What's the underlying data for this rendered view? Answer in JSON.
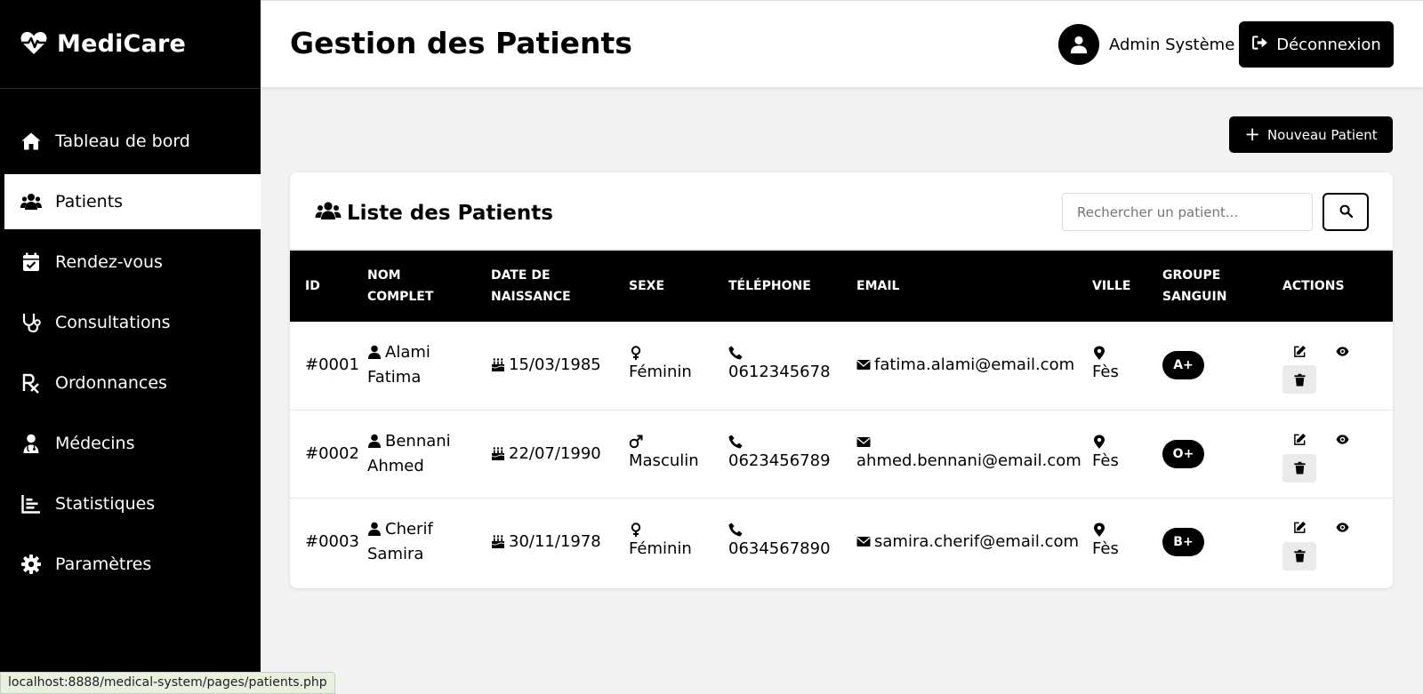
{
  "app": {
    "name": "MediCare"
  },
  "sidebar": {
    "items": [
      {
        "label": "Tableau de bord",
        "icon": "home-icon",
        "active": false
      },
      {
        "label": "Patients",
        "icon": "users-icon",
        "active": true
      },
      {
        "label": "Rendez-vous",
        "icon": "calendar-check-icon",
        "active": false
      },
      {
        "label": "Consultations",
        "icon": "stethoscope-icon",
        "active": false
      },
      {
        "label": "Ordonnances",
        "icon": "prescription-icon",
        "active": false
      },
      {
        "label": "Médecins",
        "icon": "doctor-icon",
        "active": false
      },
      {
        "label": "Statistiques",
        "icon": "chart-icon",
        "active": false
      },
      {
        "label": "Paramètres",
        "icon": "gear-icon",
        "active": false
      }
    ]
  },
  "header": {
    "title": "Gestion des Patients",
    "user_name": "Admin Système",
    "logout_label": "Déconnexion"
  },
  "toolbar": {
    "new_patient_label": "Nouveau Patient"
  },
  "list": {
    "title": "Liste des Patients",
    "search_placeholder": "Rechercher un patient...",
    "columns": [
      [
        "ID"
      ],
      [
        "NOM",
        "COMPLET"
      ],
      [
        "DATE DE",
        "NAISSANCE"
      ],
      [
        "SEXE"
      ],
      [
        "TÉLÉPHONE"
      ],
      [
        "EMAIL"
      ],
      [
        "VILLE"
      ],
      [
        "GROUPE",
        "SANGUIN"
      ],
      [
        "ACTIONS"
      ]
    ],
    "rows": [
      {
        "id": "#0001",
        "name1": "Alami",
        "name2": "Fatima",
        "dob": "15/03/1985",
        "sex": "Féminin",
        "sex_icon": "venus-icon",
        "phone": "0612345678",
        "email": "fatima.alami@email.com",
        "email_inline": true,
        "city": "Fès",
        "blood": "A+"
      },
      {
        "id": "#0002",
        "name1": "Bennani",
        "name2": "Ahmed",
        "dob": "22/07/1990",
        "sex": "Masculin",
        "sex_icon": "mars-icon",
        "phone": "0623456789",
        "email": "ahmed.bennani@email.com",
        "email_inline": false,
        "city": "Fès",
        "blood": "O+"
      },
      {
        "id": "#0003",
        "name1": "Cherif",
        "name2": "Samira",
        "dob": "30/11/1978",
        "sex": "Féminin",
        "sex_icon": "venus-icon",
        "phone": "0634567890",
        "email": "samira.cherif@email.com",
        "email_inline": true,
        "city": "Fès",
        "blood": "B+"
      }
    ]
  },
  "status_bar": {
    "url": "localhost:8888/medical-system/pages/patients.php"
  }
}
